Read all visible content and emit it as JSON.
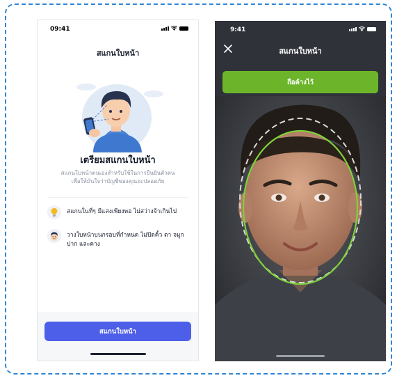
{
  "left_screen": {
    "status_time": "09:41",
    "title": "สแกนใบหน้า",
    "heading": "เตรียมสแกนใบหน้า",
    "subtitle_line1": "สแกนใบหน้าตนเองสำหรับใช้ในการยืนยันตัวตน",
    "subtitle_line2": "เพื่อให้มั่นใจว่าบัญชีของคุณจะปลอดภัย",
    "tips": [
      {
        "icon": "lightbulb-icon",
        "text": "สแกนในที่ๆ มีแสงเพียงพอ ไม่สว่างจ้าเกินไป"
      },
      {
        "icon": "face-icon",
        "text": "วางใบหน้าบนกรอบที่กำหนด ไม่ปิดคิ้ว ตา จมูก ปาก และคาง"
      }
    ],
    "button_label": "สแกนใบหน้า"
  },
  "right_screen": {
    "status_time": "9:41",
    "title": "สแกนใบหน้า",
    "hold_label": "ถือค้างไว้"
  },
  "colors": {
    "primary": "#4d5ee8",
    "success": "#6cb52a",
    "frame_dashed": "#2f86d4",
    "dark_bg": "#2f3238"
  }
}
